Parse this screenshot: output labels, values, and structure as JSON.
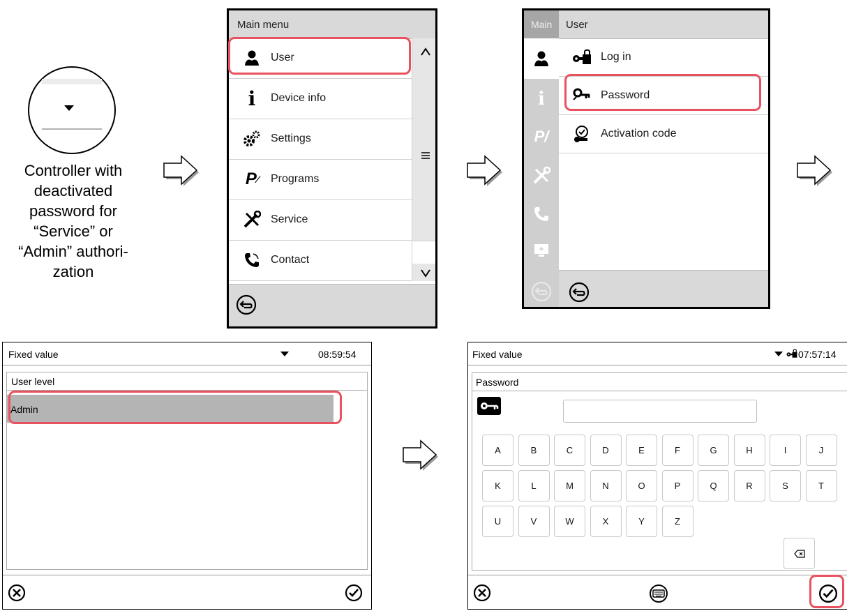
{
  "caption": {
    "line1": "Controller with",
    "line2": "deactivated",
    "line3": "password for",
    "line4": "“Service” or",
    "line5": "“Admin” authori-",
    "line6": "zation"
  },
  "main_menu": {
    "title": "Main menu",
    "items": [
      {
        "label": "User",
        "icon": "user-icon"
      },
      {
        "label": "Device info",
        "icon": "info-icon"
      },
      {
        "label": "Settings",
        "icon": "gears-icon"
      },
      {
        "label": "Programs",
        "icon": "programs-icon"
      },
      {
        "label": "Service",
        "icon": "tools-icon"
      },
      {
        "label": "Contact",
        "icon": "phone-icon"
      }
    ]
  },
  "user_menu": {
    "tab": "Main",
    "title": "User",
    "items": [
      {
        "label": "Log in",
        "icon": "login-key-icon"
      },
      {
        "label": "Password",
        "icon": "password-key-icon"
      },
      {
        "label": "Activation code",
        "icon": "activation-icon"
      }
    ]
  },
  "user_level_screen": {
    "header_title": "Fixed value",
    "time": "08:59:54",
    "list_title": "User level",
    "selected": "Admin"
  },
  "password_screen": {
    "header_title": "Fixed value",
    "time": "07:57:14",
    "field_title": "Password",
    "field_value": "",
    "keys_row1": [
      "A",
      "B",
      "C",
      "D",
      "E",
      "F",
      "G",
      "H",
      "I",
      "J"
    ],
    "keys_row2": [
      "K",
      "L",
      "M",
      "N",
      "O",
      "P",
      "Q",
      "R",
      "S",
      "T"
    ],
    "keys_row3": [
      "U",
      "V",
      "W",
      "X",
      "Y",
      "Z"
    ]
  },
  "colors": {
    "highlight": "#e8525e",
    "selected_row": "#b4b4b4",
    "sidebar": "#d9d9d9"
  }
}
